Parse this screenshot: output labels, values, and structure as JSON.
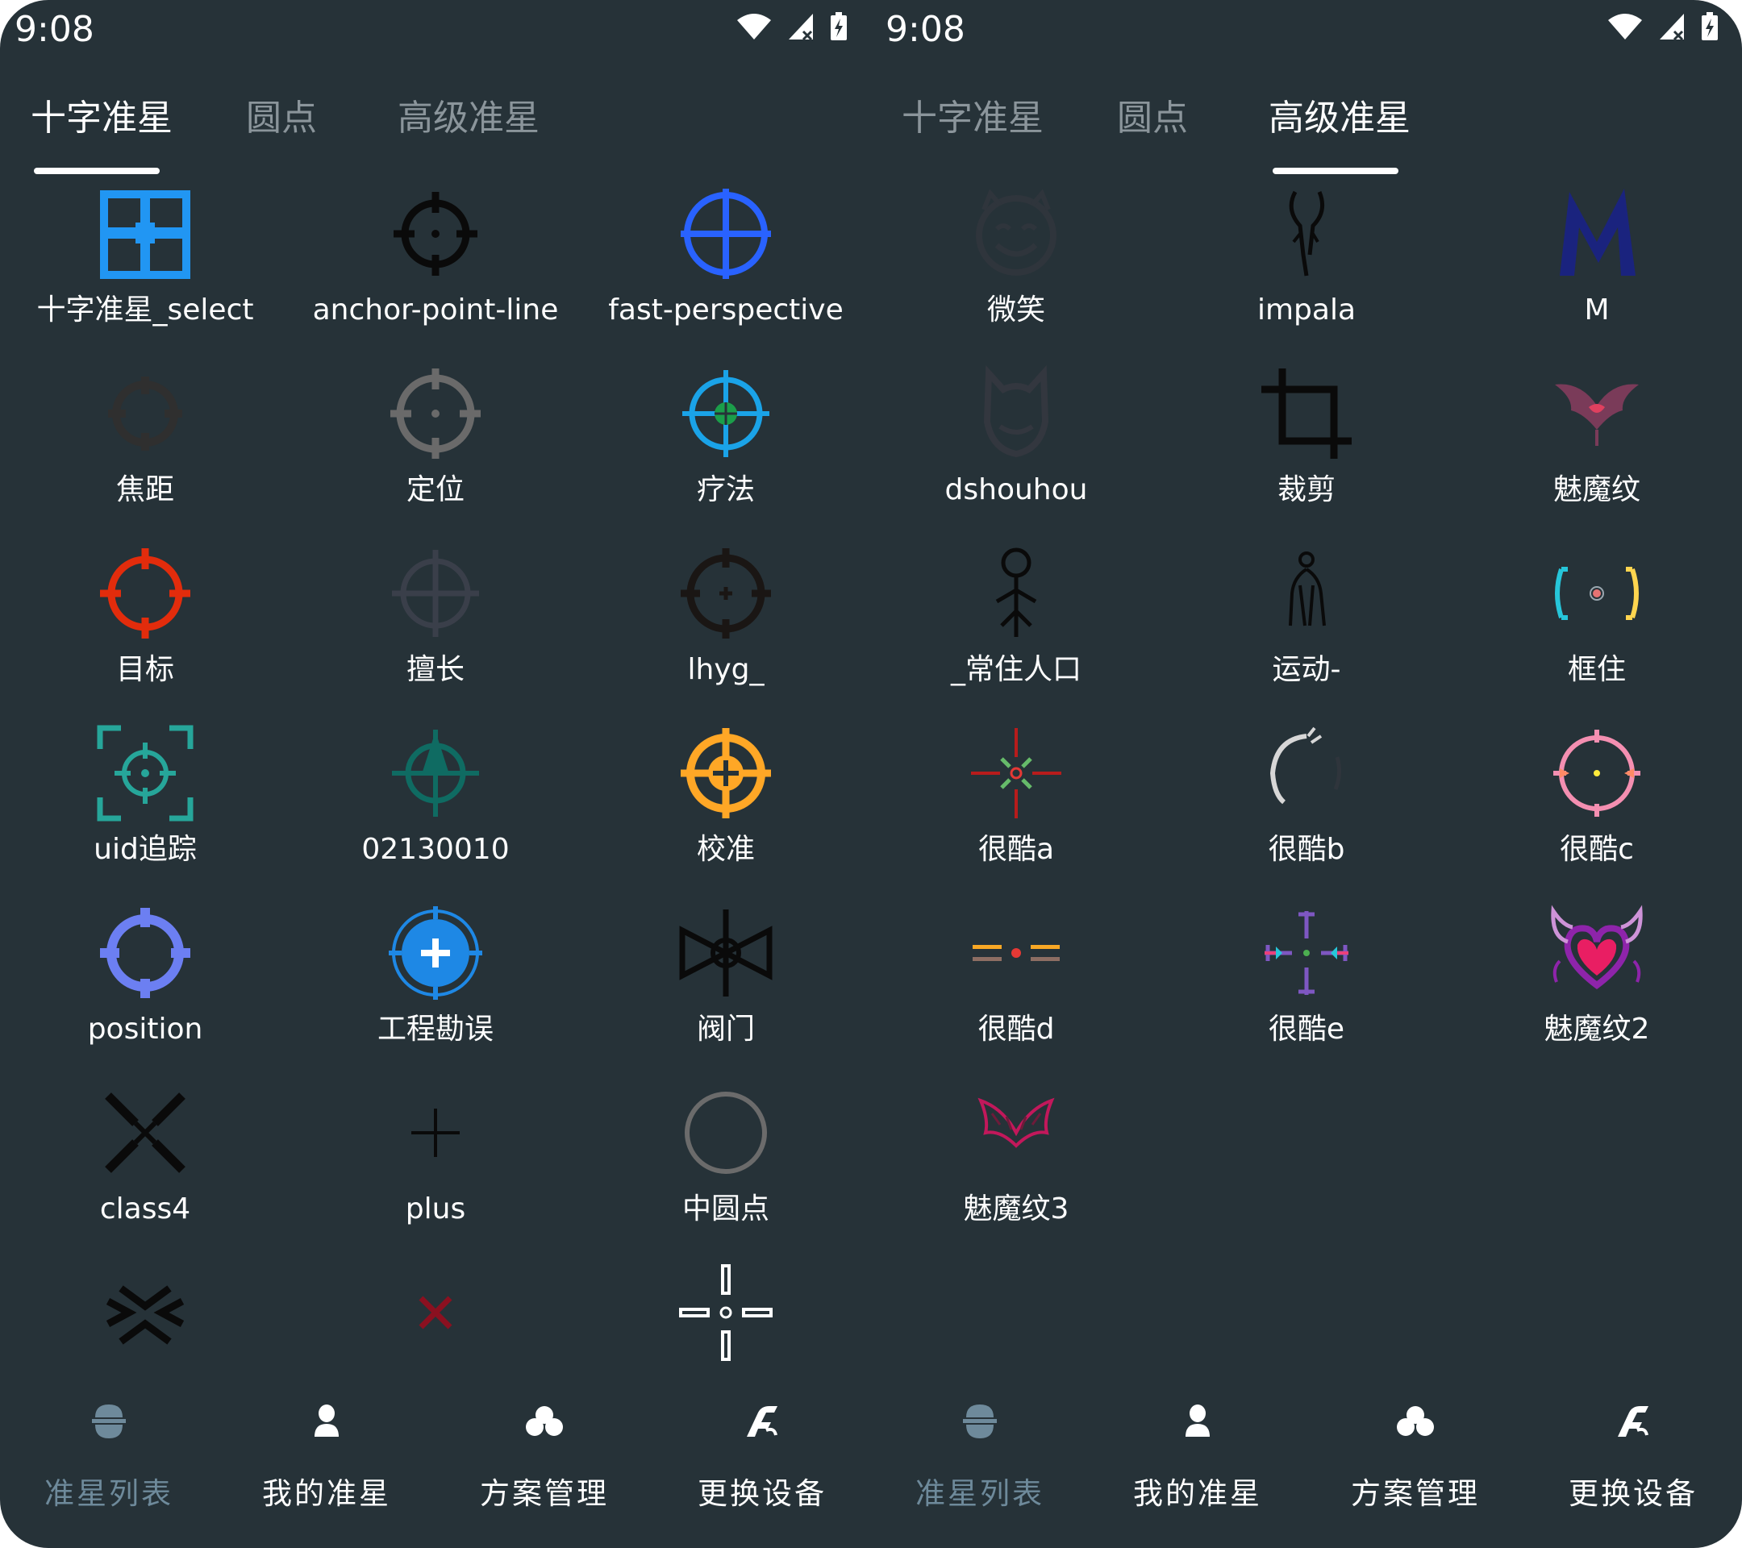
{
  "left_screen": {
    "status": {
      "time": "9:08"
    },
    "tabs": [
      {
        "label": "十字准星",
        "active": true
      },
      {
        "label": "圆点",
        "active": false
      },
      {
        "label": "高级准星",
        "active": false
      }
    ],
    "items": [
      {
        "label": "十字准星_select",
        "icon": "blue-grid-crosshair-icon"
      },
      {
        "label": "anchor-point-line",
        "icon": "black-crosshair-icon"
      },
      {
        "label": "fast-perspective",
        "icon": "blue-crosshair-icon"
      },
      {
        "label": "焦距",
        "icon": "dark-crosshair-icon"
      },
      {
        "label": "定位",
        "icon": "gray-crosshair-icon"
      },
      {
        "label": "疗法",
        "icon": "cyan-green-crosshair-icon"
      },
      {
        "label": "目标",
        "icon": "red-crosshair-icon"
      },
      {
        "label": "擅长",
        "icon": "faint-crosshair-icon"
      },
      {
        "label": "lhyg_",
        "icon": "dark-crosshair-plus-icon"
      },
      {
        "label": "uid追踪",
        "icon": "teal-bracket-crosshair-icon"
      },
      {
        "label": "02130010",
        "icon": "teal-arrow-crosshair-icon"
      },
      {
        "label": "校准",
        "icon": "orange-crosshair-icon"
      },
      {
        "label": "position",
        "icon": "violet-crosshair-icon"
      },
      {
        "label": "工程勘误",
        "icon": "blue-plus-circle-icon"
      },
      {
        "label": "阀门",
        "icon": "valve-icon"
      },
      {
        "label": "class4",
        "icon": "black-x-arrows-icon"
      },
      {
        "label": "plus",
        "icon": "thin-plus-icon"
      },
      {
        "label": "中圆点",
        "icon": "gray-ring-icon"
      },
      {
        "label": "",
        "icon": "black-chevrons-icon"
      },
      {
        "label": "",
        "icon": "red-x-icon"
      },
      {
        "label": "",
        "icon": "white-gap-cross-icon"
      }
    ],
    "nav": [
      {
        "label": "准星列表",
        "icon": "crosshair-list-icon",
        "active": true
      },
      {
        "label": "我的准星",
        "icon": "person-icon",
        "active": false
      },
      {
        "label": "方案管理",
        "icon": "cloud-icon",
        "active": false
      },
      {
        "label": "更换设备",
        "icon": "device-switch-icon",
        "active": false
      }
    ]
  },
  "right_screen": {
    "status": {
      "time": "9:08"
    },
    "tabs": [
      {
        "label": "十字准星",
        "active": false
      },
      {
        "label": "圆点",
        "active": false
      },
      {
        "label": "高级准星",
        "active": true
      }
    ],
    "items": [
      {
        "label": "微笑",
        "icon": "smile-face-icon"
      },
      {
        "label": "impala",
        "icon": "impala-horns-icon"
      },
      {
        "label": "M",
        "icon": "letter-m-icon"
      },
      {
        "label": "dshouhou",
        "icon": "mask-outline-icon"
      },
      {
        "label": "裁剪",
        "icon": "crop-icon"
      },
      {
        "label": "魅魔纹",
        "icon": "succubus-mark-icon"
      },
      {
        "label": "_常住人口",
        "icon": "stick-figure-icon"
      },
      {
        "label": "运动-",
        "icon": "walking-figure-icon"
      },
      {
        "label": "框住",
        "icon": "bracket-dot-icon"
      },
      {
        "label": "很酷a",
        "icon": "red-green-star-crosshair-icon"
      },
      {
        "label": "很酷b",
        "icon": "broken-circle-icon"
      },
      {
        "label": "很酷c",
        "icon": "pink-ring-crosshair-icon"
      },
      {
        "label": "很酷d",
        "icon": "orange-bars-dot-icon"
      },
      {
        "label": "很酷e",
        "icon": "purple-arrows-crosshair-icon"
      },
      {
        "label": "魅魔纹2",
        "icon": "purple-heart-wings-icon"
      },
      {
        "label": "魅魔纹3",
        "icon": "red-wings-icon"
      }
    ],
    "nav": [
      {
        "label": "准星列表",
        "icon": "crosshair-list-icon",
        "active": true
      },
      {
        "label": "我的准星",
        "icon": "person-icon",
        "active": false
      },
      {
        "label": "方案管理",
        "icon": "cloud-icon",
        "active": false
      },
      {
        "label": "更换设备",
        "icon": "device-switch-icon",
        "active": false
      }
    ]
  },
  "colors": {
    "background": "#263238",
    "text": "#ffffff",
    "tab_inactive": "#8b959b",
    "nav_active": "#6e8a9b",
    "nav_icon_active": "#6e8a9b",
    "nav_icon": "#ffffff"
  }
}
